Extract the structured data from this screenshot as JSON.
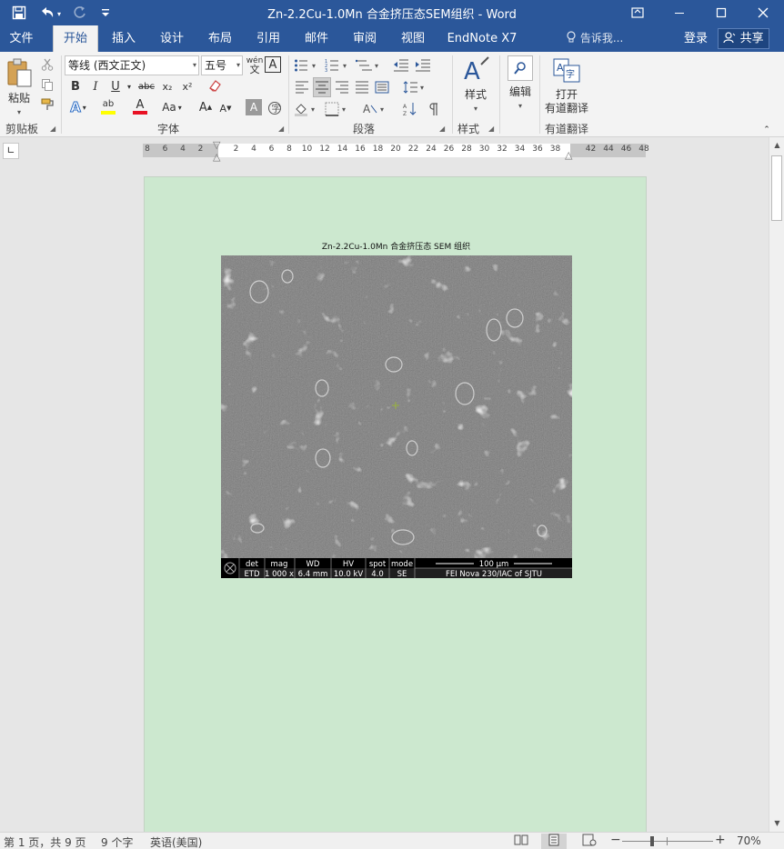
{
  "window": {
    "title": "Zn-2.2Cu-1.0Mn 合金挤压态SEM组织 - Word",
    "quick_access": {
      "save_icon": "save-icon",
      "undo_icon": "undo-icon",
      "redo_icon": "redo-icon",
      "customize_icon": "customize-qat-icon"
    },
    "controls": [
      "ribbon-display-icon",
      "minimize-icon",
      "maximize-icon",
      "close-icon"
    ]
  },
  "tabs": [
    {
      "label": "文件",
      "active": false
    },
    {
      "label": "开始",
      "active": true
    },
    {
      "label": "插入",
      "active": false
    },
    {
      "label": "设计",
      "active": false
    },
    {
      "label": "布局",
      "active": false
    },
    {
      "label": "引用",
      "active": false
    },
    {
      "label": "邮件",
      "active": false
    },
    {
      "label": "审阅",
      "active": false
    },
    {
      "label": "视图",
      "active": false
    },
    {
      "label": "EndNote X7",
      "active": false
    }
  ],
  "tell_me": "告诉我...",
  "login": "登录",
  "share": "共享",
  "ribbon": {
    "clipboard": {
      "paste_label": "粘贴",
      "group_label": "剪贴板"
    },
    "font": {
      "font_name": "等线 (西文正文)",
      "font_size": "五号",
      "group_label": "字体",
      "buttons": {
        "bold": "B",
        "italic": "I",
        "underline": "U",
        "strike": "abc",
        "subscript": "x₂",
        "superscript": "x²",
        "change_case": "Aa",
        "grow": "A",
        "shrink": "A",
        "char_border": "A",
        "char_shade": "A",
        "phonetic": "wén",
        "highlight": "ab",
        "font_color": "A",
        "text_effect": "A"
      }
    },
    "paragraph": {
      "group_label": "段落"
    },
    "styles": {
      "label": "样式",
      "group_label": "样式"
    },
    "editing": {
      "label": "编辑"
    },
    "youdao": {
      "label_line1": "打开",
      "label_line2": "有道翻译",
      "group_label": "有道翻译"
    },
    "accent": "#2b579a"
  },
  "ruler": {
    "left_numbers": [
      "8",
      "6",
      "4",
      "2"
    ],
    "right_numbers": [
      "2",
      "4",
      "6",
      "8",
      "10",
      "12",
      "14",
      "16",
      "18",
      "20",
      "22",
      "24",
      "26",
      "28",
      "30",
      "32",
      "34",
      "36",
      "38"
    ],
    "far_numbers": [
      "42",
      "44",
      "46",
      "48"
    ],
    "tab_selector": "∟"
  },
  "document": {
    "page_color": "#cce8cf",
    "caption": "Zn-2.2Cu-1.0Mn  合金挤压态 SEM 组织",
    "sem": {
      "headers": [
        "det",
        "mag",
        "WD",
        "HV",
        "spot",
        "mode"
      ],
      "values": [
        "ETD",
        "1 000 x",
        "6.4 mm",
        "10.0 kV",
        "4.0",
        "SE"
      ],
      "scale_label": "100 µm",
      "instrument": "FEI Nova 230/IAC of SJTU"
    }
  },
  "status": {
    "page": "第 1 页，共 9 页",
    "words": "9 个字",
    "language": "英语(美国)",
    "zoom": "70%",
    "zoom_minus": "−",
    "zoom_plus": "+"
  }
}
